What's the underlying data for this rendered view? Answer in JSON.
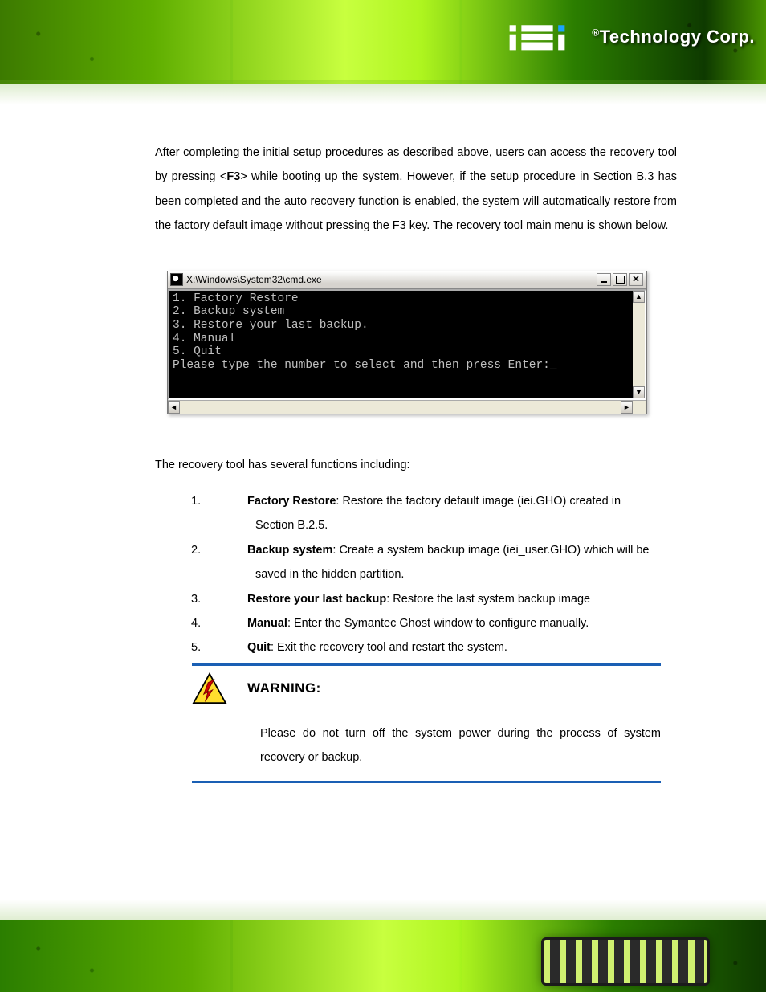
{
  "brand": {
    "reg": "®",
    "name": "Technology Corp."
  },
  "intro": {
    "part1": "After completing the initial setup procedures as described above, users can access the recovery tool by pressing <",
    "key": "F3",
    "part2": "> while booting up the system. However, if the setup procedure in Section B.3 has been completed and the auto recovery function is enabled, the system will automatically restore from the factory default image without pressing the F3 key. The recovery tool main menu is shown below."
  },
  "cmd": {
    "title": "X:\\Windows\\System32\\cmd.exe",
    "lines": [
      "1. Factory Restore",
      "2. Backup system",
      "3. Restore your last backup.",
      "4. Manual",
      "5. Quit",
      "Please type the number to select and then press Enter:_"
    ],
    "btn_close": "✕"
  },
  "subhead": "The recovery tool has several functions including:",
  "list": {
    "n1": "1.",
    "b1": "Factory Restore",
    "t1a": ": Restore the factory default image (iei.GHO) created in",
    "t1b": "Section B.2.5.",
    "n2": "2.",
    "b2": "Backup system",
    "t2a": ": Create a system backup image (iei_user.GHO) which will be",
    "t2b": "saved in the hidden partition.",
    "n3": "3.",
    "b3": "Restore your last backup",
    "t3": ": Restore the last system backup image",
    "n4": "4.",
    "b4": "Manual",
    "t4": ": Enter the Symantec Ghost window to configure manually.",
    "n5": "5.",
    "b5": "Quit",
    "t5": ": Exit the recovery tool and restart the system."
  },
  "warning": {
    "title": "WARNING:",
    "text": "Please do not turn off the system power during the process of system recovery or backup."
  }
}
